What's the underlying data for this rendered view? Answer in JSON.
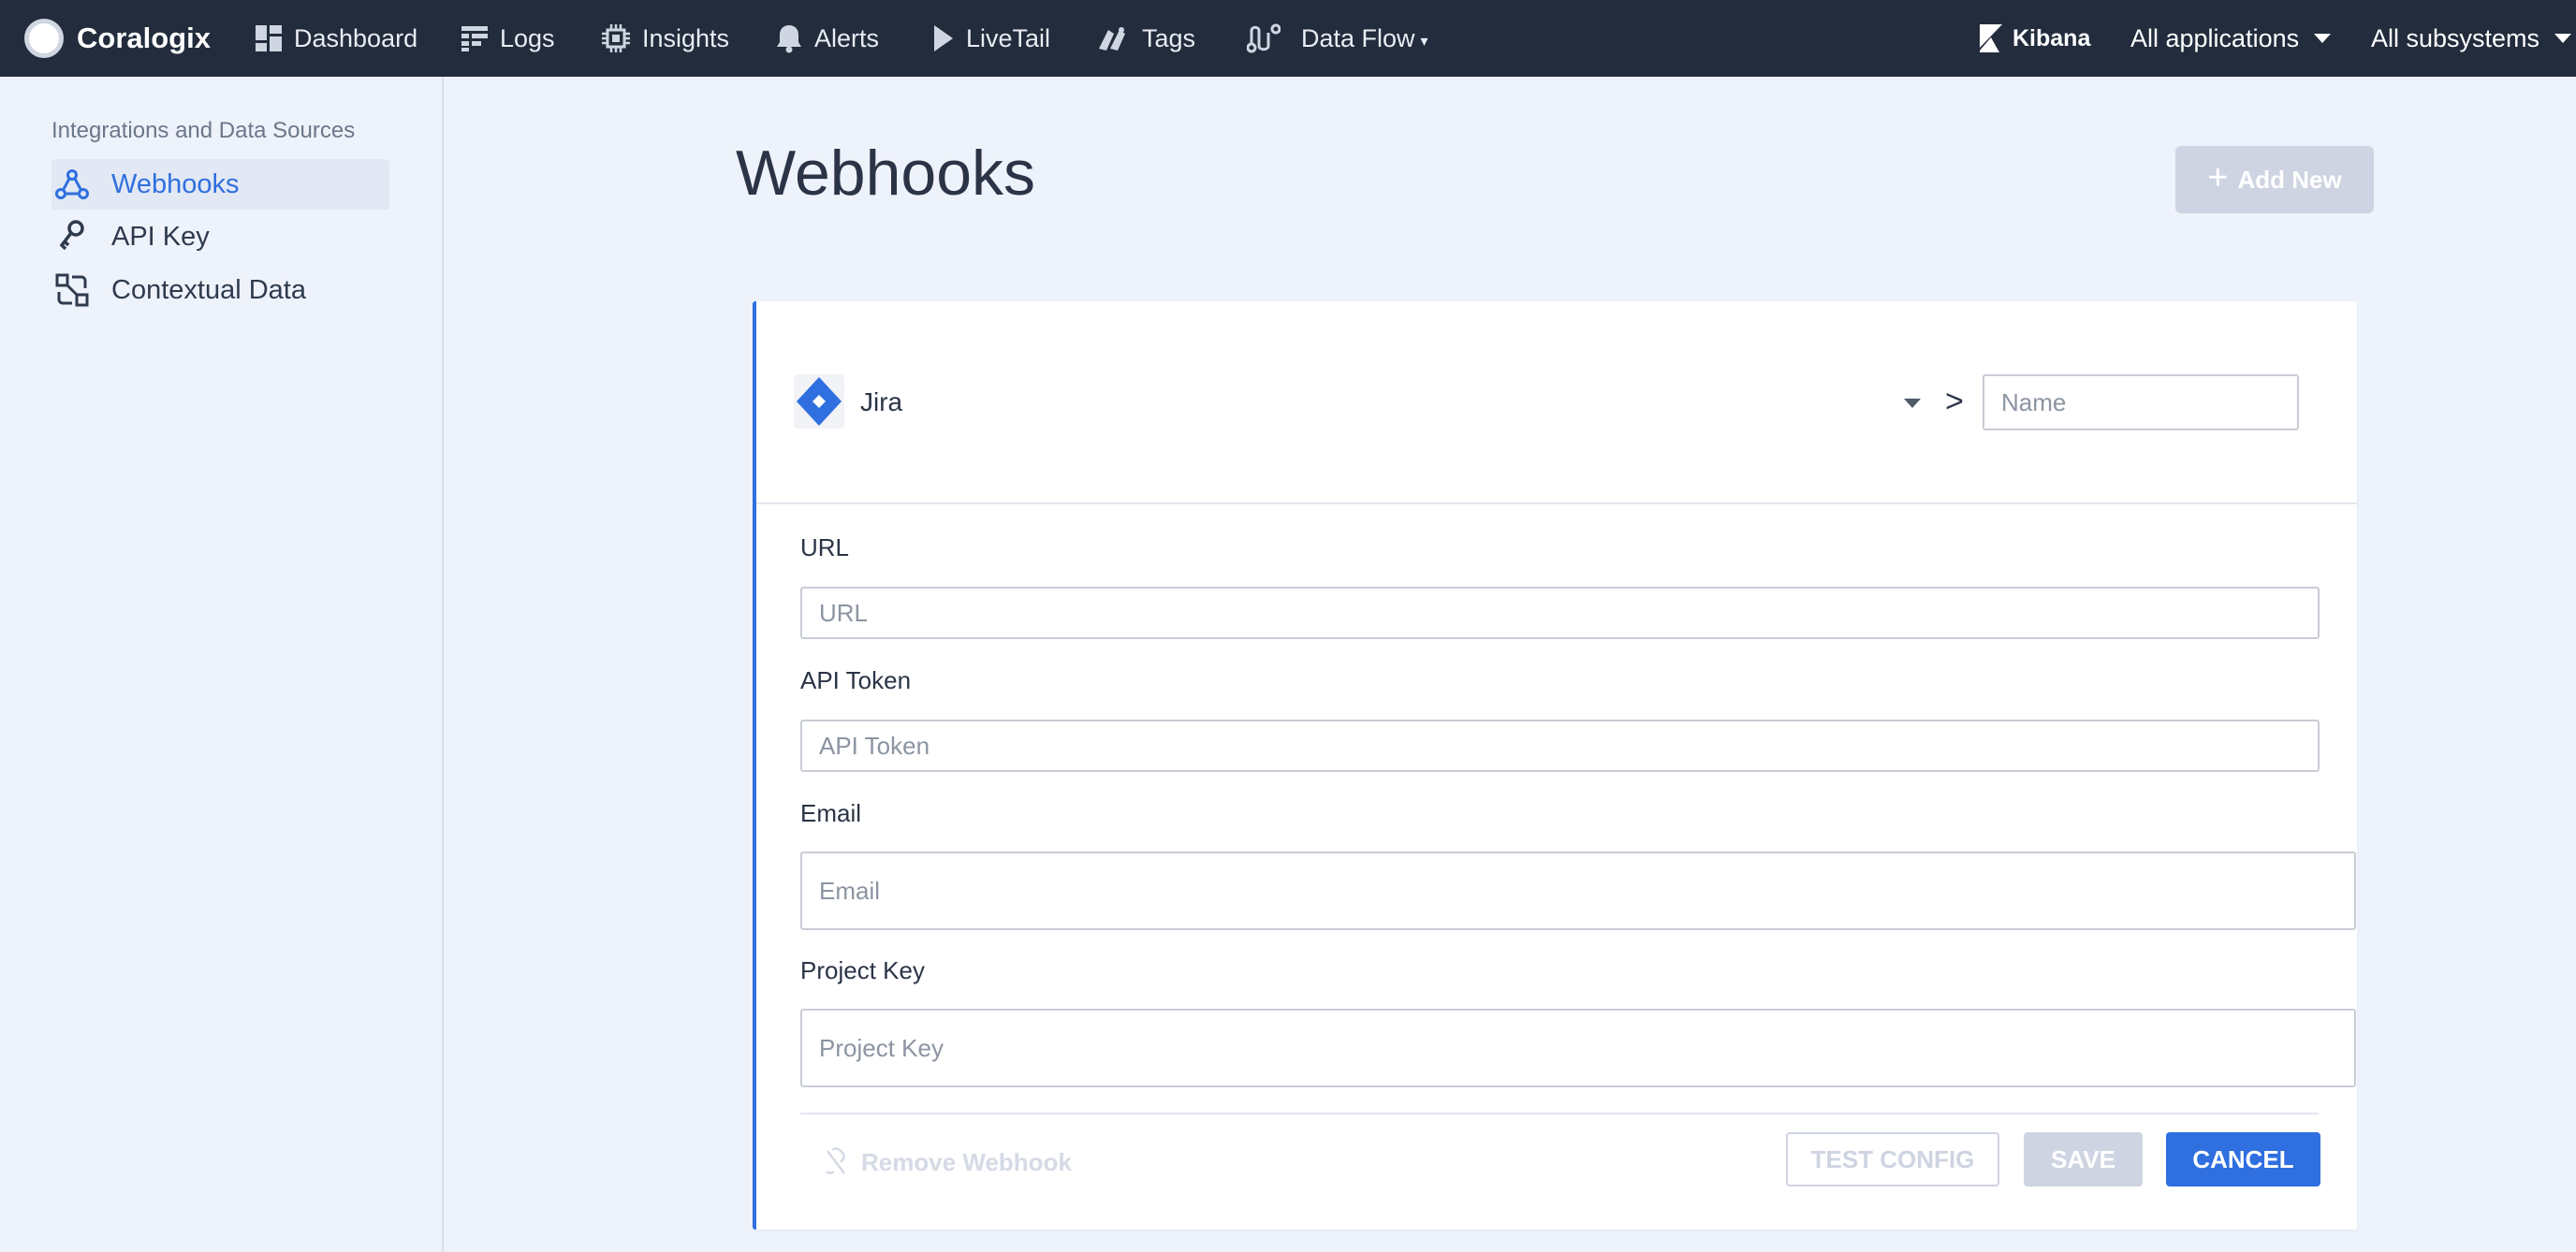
{
  "app": {
    "name": "Coralogix"
  },
  "nav": {
    "items": [
      {
        "label": "Dashboard",
        "icon": "dashboard-icon"
      },
      {
        "label": "Logs",
        "icon": "logs-icon"
      },
      {
        "label": "Insights",
        "icon": "chip-icon"
      },
      {
        "label": "Alerts",
        "icon": "bell-icon"
      },
      {
        "label": "LiveTail",
        "icon": "play-icon"
      },
      {
        "label": "Tags",
        "icon": "tags-icon"
      },
      {
        "label": "Data Flow",
        "icon": "data-flow-icon",
        "caret": "▾"
      }
    ],
    "kibana": "Kibana",
    "applications": "All applications",
    "subsystems": "All subsystems"
  },
  "sidebar": {
    "section": "Integrations and Data Sources",
    "items": [
      {
        "label": "Webhooks",
        "icon": "webhook-icon",
        "active": true
      },
      {
        "label": "API Key",
        "icon": "key-icon",
        "active": false
      },
      {
        "label": "Contextual Data",
        "icon": "contextual-data-icon",
        "active": false
      }
    ]
  },
  "main": {
    "title": "Webhooks",
    "add_button": {
      "plus": "+",
      "label": "Add New"
    }
  },
  "form": {
    "type": {
      "selected": "Jira",
      "separator": ">"
    },
    "name": {
      "placeholder": "Name",
      "value": ""
    },
    "fields": [
      {
        "label": "URL",
        "placeholder": "URL",
        "value": ""
      },
      {
        "label": "API Token",
        "placeholder": "API Token",
        "value": ""
      },
      {
        "label": "Email",
        "placeholder": "Email",
        "value": ""
      },
      {
        "label": "Project Key",
        "placeholder": "Project Key",
        "value": ""
      }
    ],
    "remove_label": "Remove Webhook",
    "test_label": "TEST CONFIG",
    "save_label": "SAVE",
    "cancel_label": "CANCEL"
  },
  "colors": {
    "topbar": "#222c3c",
    "accent": "#2f6fe0",
    "disabled": "#cfd4e2",
    "background": "#eef2fa"
  }
}
